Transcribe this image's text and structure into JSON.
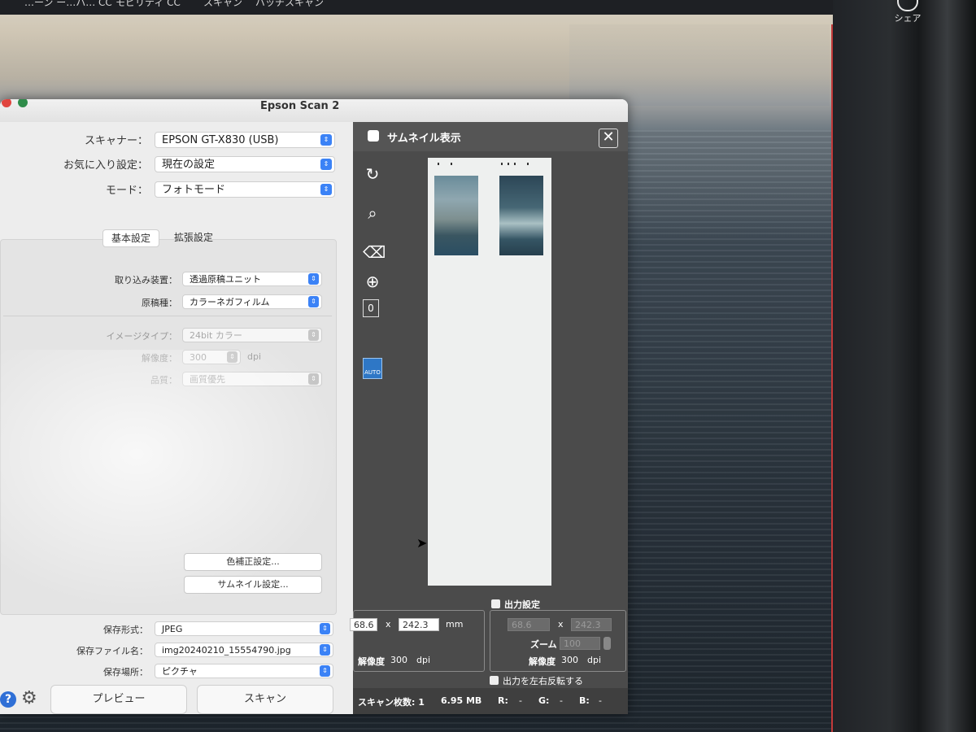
{
  "menubar": {
    "items": [
      "…ーン ー…ハ… CC",
      "モビリティ CC",
      "スキャン",
      "バッチスキャン"
    ],
    "share_label": "シェア"
  },
  "window": {
    "title": "Epson Scan 2"
  },
  "settings": {
    "scanner_label": "スキャナー：",
    "scanner_value": "EPSON GT-X830 (USB)",
    "favorite_label": "お気に入り設定：",
    "favorite_value": "現在の設定",
    "mode_label": "モード：",
    "mode_value": "フォトモード",
    "tabs": [
      "基本設定",
      "拡張設定"
    ],
    "source_label": "取り込み装置：",
    "source_value": "透過原稿ユニット",
    "doc_type_label": "原稿種：",
    "doc_type_value": "カラーネガフィルム",
    "image_type_label": "イメージタイプ：",
    "image_type_value": "24bit カラー",
    "resolution_label": "解像度：",
    "resolution_value": "300",
    "resolution_unit": "dpi",
    "quality_label": "品質：",
    "quality_value": "画質優先",
    "color_correction_button": "色補正設定...",
    "thumbnail_settings_button": "サムネイル設定...",
    "format_label": "保存形式：",
    "format_value": "JPEG",
    "filename_label": "保存ファイル名：",
    "filename_value": "img20240210_15554790.jpg",
    "location_label": "保存場所：",
    "location_value": "ピクチャ",
    "preview_button": "プレビュー",
    "scan_button": "スキャン"
  },
  "thumbnail_panel": {
    "title": "サムネイル表示",
    "width_value": "68.6",
    "times": "x",
    "height_value": "242.3",
    "unit": "mm",
    "resolution_label": "解像度",
    "resolution_value": "300",
    "resolution_unit": "dpi",
    "output_settings_label": "出力設定",
    "out_width_value": "68.6",
    "out_height_value": "242.3",
    "zoom_label": "ズーム",
    "zoom_value": "100",
    "out_resolution_label": "解像度",
    "out_resolution_value": "300",
    "out_resolution_unit": "dpi",
    "mirror_label": "出力を左右反転する",
    "scan_count_label": "スキャン枚数: 1",
    "file_size": "6.95 MB",
    "r_label": "R:",
    "r_value": "-",
    "g_label": "G:",
    "g_value": "-",
    "b_label": "B:",
    "b_value": "-",
    "auto_label": "AUTO"
  },
  "colors": {
    "accent": "#3b82f6",
    "window_bg": "#ececec",
    "panel_bg": "#4b4b4b"
  }
}
